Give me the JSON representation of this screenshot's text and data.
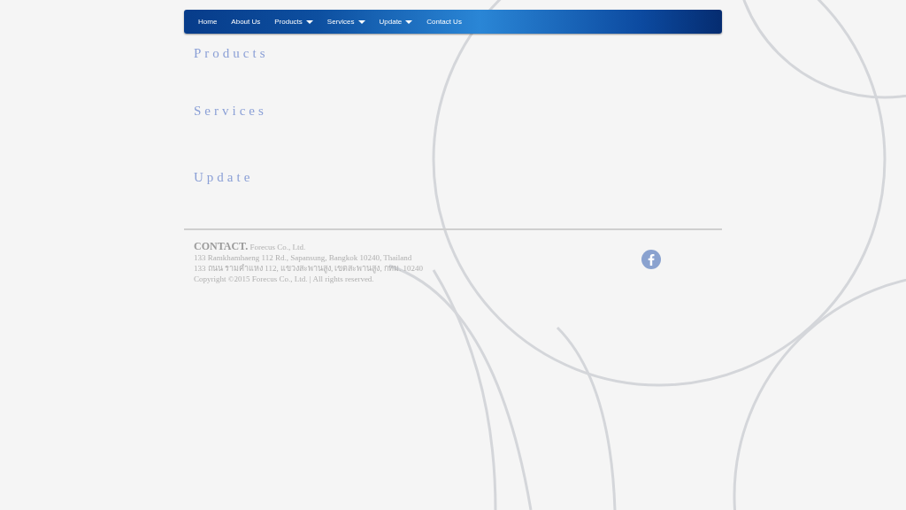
{
  "nav": {
    "items": [
      {
        "label": "Home",
        "dropdown": false
      },
      {
        "label": "About Us",
        "dropdown": false
      },
      {
        "label": "Products",
        "dropdown": true
      },
      {
        "label": "Services",
        "dropdown": true
      },
      {
        "label": "Update",
        "dropdown": true
      },
      {
        "label": "Contact Us",
        "dropdown": false
      }
    ]
  },
  "sections": [
    {
      "heading": "Products"
    },
    {
      "heading": "Services"
    },
    {
      "heading": "Update"
    }
  ],
  "footer": {
    "contact_label": "CONTACT.",
    "company": "Forecus Co., Ltd.",
    "lines": [
      "133 Ramkhamhaeng 112 Rd., Sapansung, Bangkok 10240, Thailand",
      "133 ถนน รามคำแหง 112, แขวงสะพานสูง, เขตสะพานสูง, กทม. 10240",
      "Copyright ©2015 Forecus Co., Ltd.  |  All rights reserved."
    ]
  }
}
